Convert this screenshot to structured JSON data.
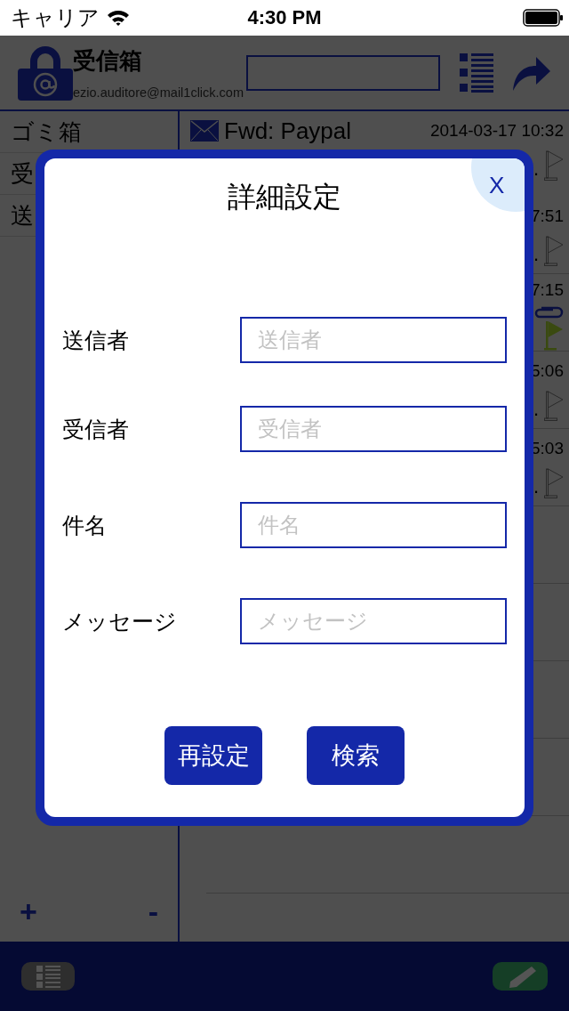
{
  "status_bar": {
    "carrier": "キャリア",
    "time": "4:30 PM"
  },
  "header": {
    "title": "受信箱",
    "account": "ezio.auditore@mail1click.com"
  },
  "sidebar": {
    "items": [
      {
        "label": "ゴミ箱"
      },
      {
        "label": "受"
      },
      {
        "label": "送"
      }
    ],
    "add": "+",
    "remove": "-"
  },
  "messages": [
    {
      "subject": "Fwd: Paypal",
      "time": "2014-03-17 10:32",
      "tail": ".",
      "attachment": false,
      "flagged": false
    },
    {
      "time": "7:51",
      "tail": ".",
      "attachment": false,
      "flagged": false
    },
    {
      "time": "7:15",
      "attachment": true,
      "flagged": true
    },
    {
      "time": "5:06",
      "tail": ".",
      "attachment": false,
      "flagged": false
    },
    {
      "time": "5:03",
      "tail": ".",
      "attachment": false,
      "flagged": false
    }
  ],
  "dialog": {
    "title": "詳細設定",
    "close": "X",
    "fields": [
      {
        "label": "送信者",
        "placeholder": "送信者"
      },
      {
        "label": "受信者",
        "placeholder": "受信者"
      },
      {
        "label": "件名",
        "placeholder": "件名"
      },
      {
        "label": "メッセージ",
        "placeholder": "メッセージ"
      }
    ],
    "buttons": [
      "再設定",
      "検索"
    ]
  }
}
